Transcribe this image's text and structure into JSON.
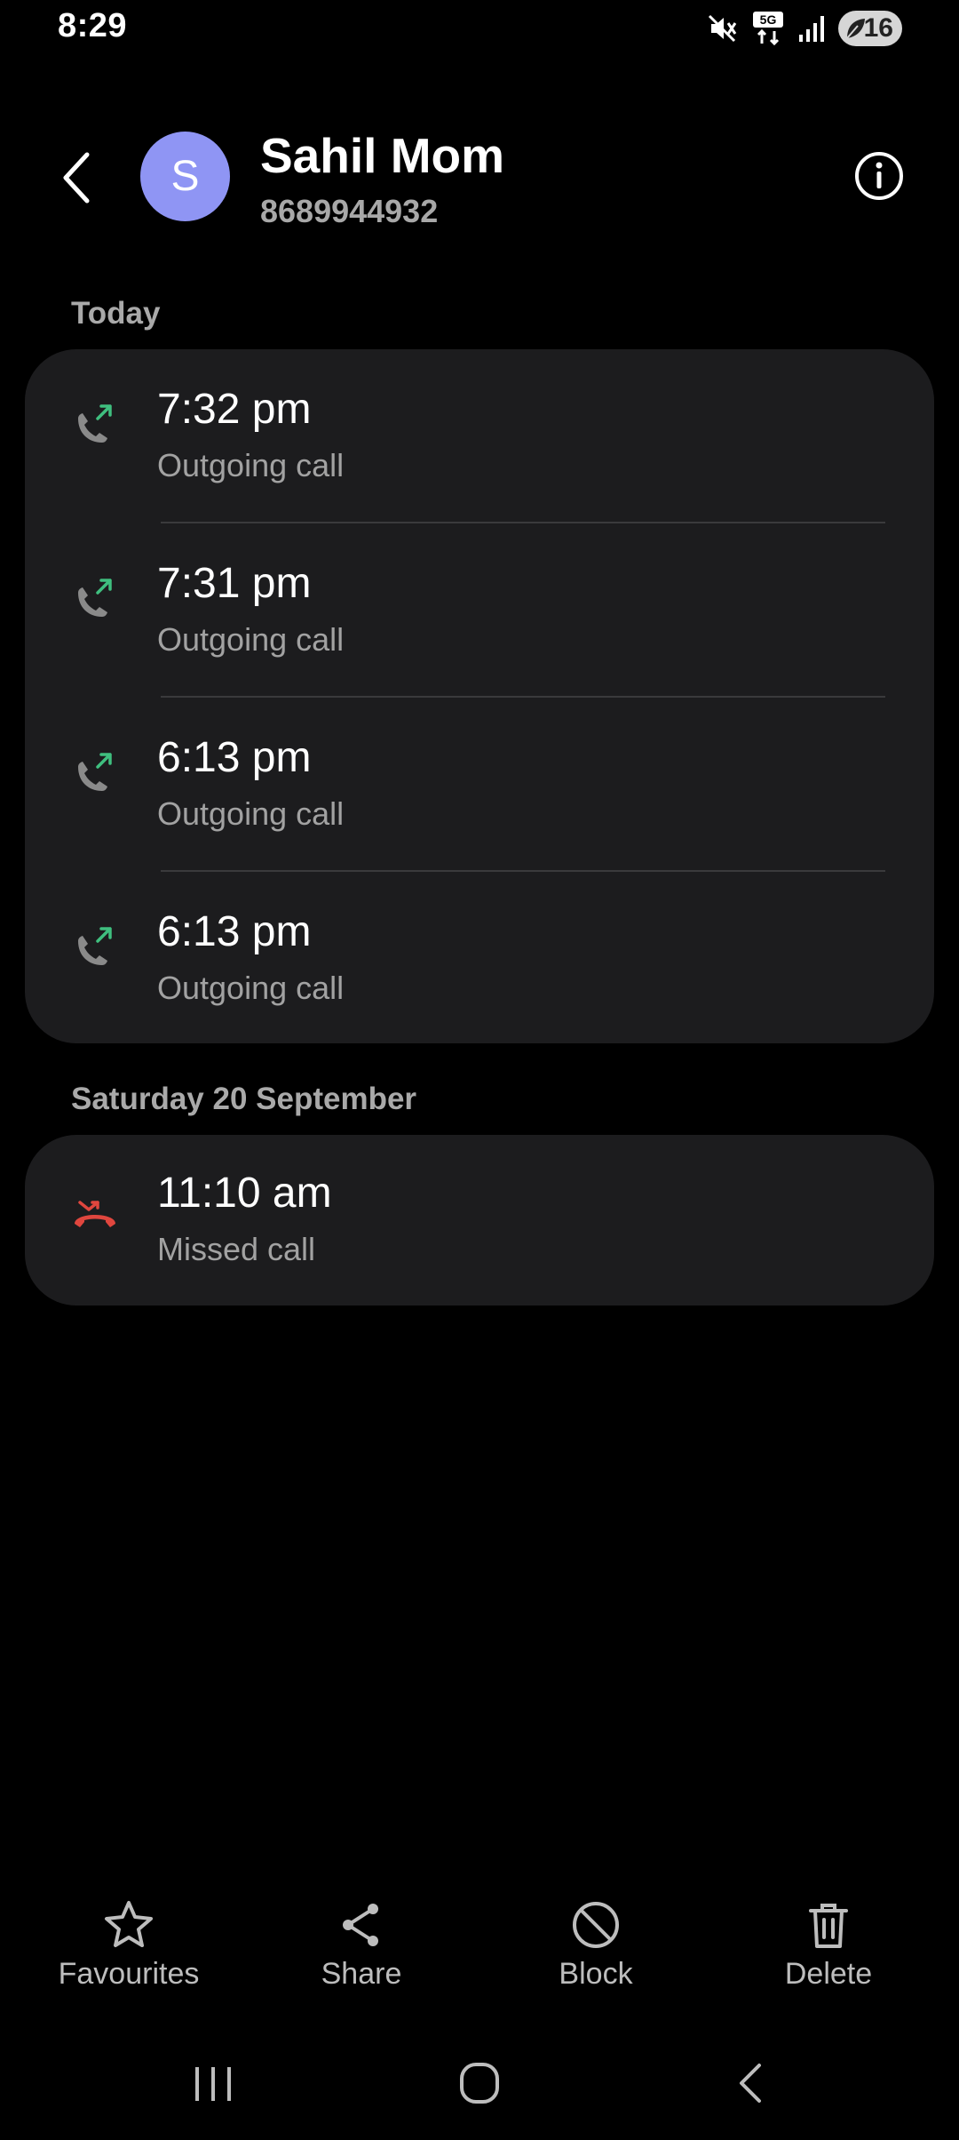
{
  "status_bar": {
    "time": "8:29",
    "battery": "16",
    "network_label": "5G",
    "icons": [
      "mute-icon",
      "5g-data-icon",
      "signal-icon",
      "battery-icon"
    ]
  },
  "header": {
    "avatar_letter": "S",
    "contact_name": "Sahil Mom",
    "contact_number": "8689944932",
    "back_icon": "chevron-left-icon",
    "info_icon": "info-icon"
  },
  "sections": [
    {
      "title": "Today",
      "calls": [
        {
          "time": "7:32 pm",
          "type": "Outgoing call",
          "icon": "outgoing-call-icon"
        },
        {
          "time": "7:31 pm",
          "type": "Outgoing call",
          "icon": "outgoing-call-icon"
        },
        {
          "time": "6:13 pm",
          "type": "Outgoing call",
          "icon": "outgoing-call-icon"
        },
        {
          "time": "6:13 pm",
          "type": "Outgoing call",
          "icon": "outgoing-call-icon"
        }
      ]
    },
    {
      "title": "Saturday 20 September",
      "calls": [
        {
          "time": "11:10 am",
          "type": "Missed call",
          "icon": "missed-call-icon"
        }
      ]
    }
  ],
  "actions": {
    "favourites": "Favourites",
    "share": "Share",
    "block": "Block",
    "delete": "Delete"
  },
  "colors": {
    "background": "#000000",
    "card": "#1c1c1e",
    "avatar": "#8f95f4",
    "outgoing_arrow": "#3fbf7f",
    "missed_call": "#e0463e",
    "secondary_text": "#a2a2a2"
  }
}
